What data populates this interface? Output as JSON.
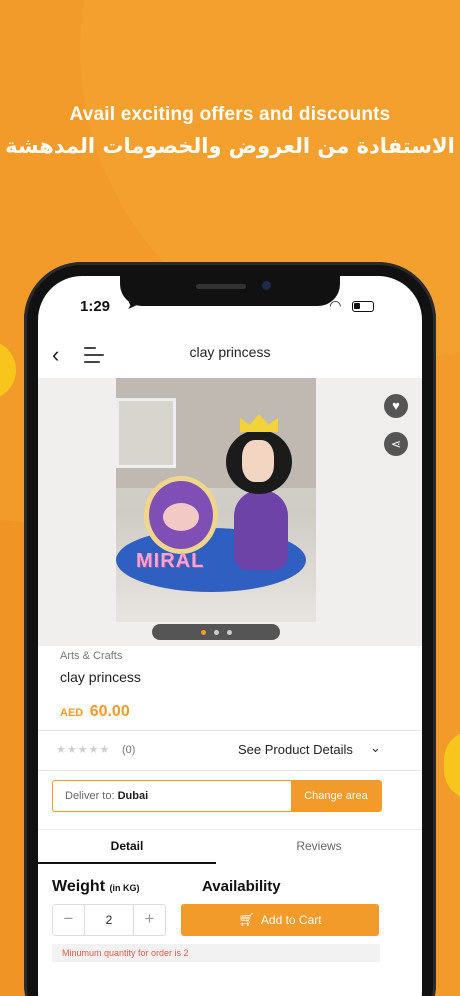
{
  "headline": {
    "english": "Avail exciting offers and discounts",
    "arabic": "الاستفادة من العروض والخصومات المدهشة"
  },
  "status_bar": {
    "time": "1:29"
  },
  "navbar": {
    "title": "clay princess"
  },
  "gallery": {
    "photo_text": "MIRAL",
    "dots": 3,
    "active_dot": 1
  },
  "product": {
    "category": "Arts & Crafts",
    "name": "clay princess",
    "currency": "AED",
    "price": "60.00"
  },
  "rating": {
    "count": "(0)",
    "stars_filled": 0,
    "stars_total": 5,
    "see_details": "See Product Details"
  },
  "delivery": {
    "label": "Deliver to:",
    "city": "Dubai",
    "change_button": "Change area"
  },
  "tabs": [
    {
      "label": "Detail",
      "active": true
    },
    {
      "label": "Reviews",
      "active": false
    }
  ],
  "options": {
    "weight_label": "Weight",
    "weight_unit": "(in KG)",
    "availability_label": "Availability",
    "quantity": "2",
    "add_to_cart": "Add to Cart",
    "min_quantity_note": "Minumum quantity for order is 2"
  },
  "colors": {
    "accent": "#f29a2a",
    "background": "#f29a2a",
    "error": "#e25a4a"
  }
}
